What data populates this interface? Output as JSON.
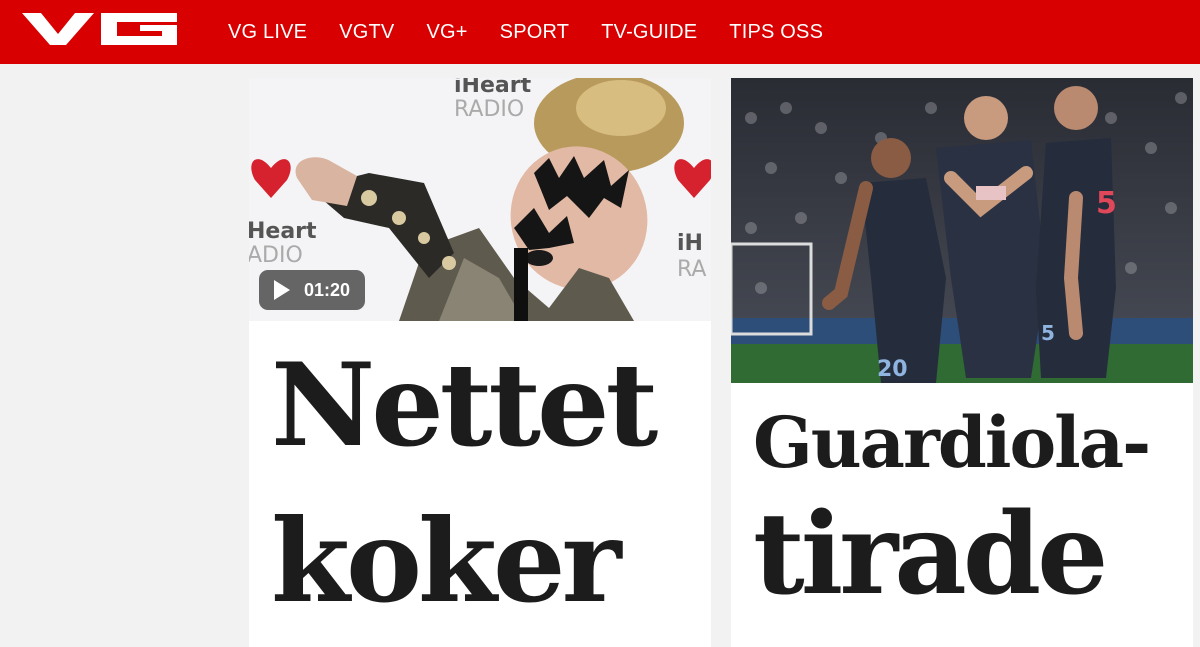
{
  "header": {
    "logo_text": "VG",
    "brand_color": "#d80000",
    "nav": [
      {
        "label": "VG LIVE"
      },
      {
        "label": "VGTV"
      },
      {
        "label": "VG+"
      },
      {
        "label": "SPORT"
      },
      {
        "label": "TV-GUIDE"
      },
      {
        "label": "TIPS OSS"
      }
    ]
  },
  "articles": [
    {
      "image_icon": "photo-performer-face-paint",
      "image_lettering": [
        "iHeart",
        "RADIO"
      ],
      "video_duration": "01:20",
      "headline_line1": "Nettet",
      "headline_line2": "koker"
    },
    {
      "image_icon": "photo-football-players",
      "shirt_numbers": [
        "20",
        "5"
      ],
      "headline_line1": "Guardiola-",
      "headline_line2": "tirade"
    }
  ]
}
